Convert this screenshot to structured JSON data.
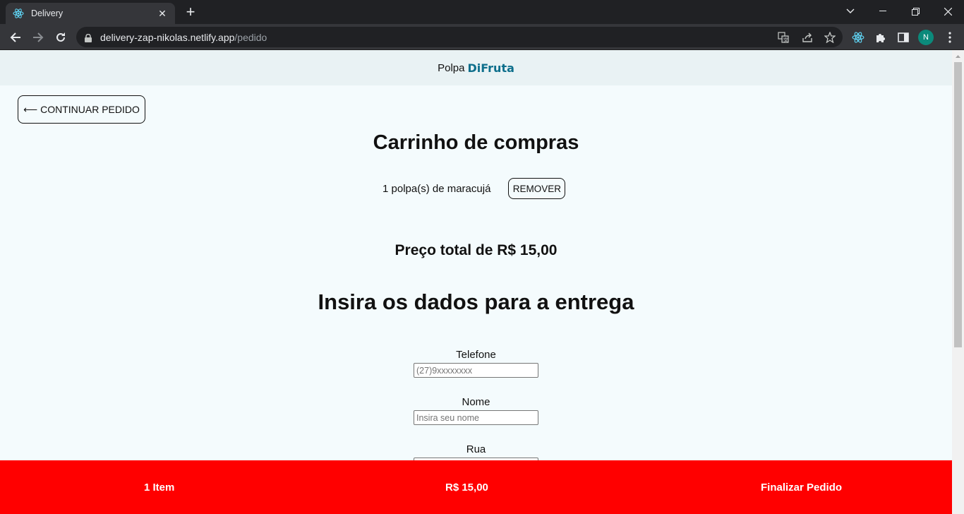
{
  "browser": {
    "tab_title": "Delivery",
    "url_domain": "delivery-zap-nikolas.netlify.app",
    "url_path": "/pedido",
    "profile_initial": "N"
  },
  "site": {
    "brand_prefix": "Polpa",
    "brand_name": "DiFruta"
  },
  "actions": {
    "back_label": "⟵ CONTINUAR PEDIDO",
    "remove_label": "REMOVER"
  },
  "cart": {
    "title": "Carrinho de compras",
    "items": [
      {
        "label": "1 polpa(s) de maracujá"
      }
    ],
    "total": "Preço total de R$ 15,00"
  },
  "form": {
    "title": "Insira os dados para a entrega",
    "fields": [
      {
        "label": "Telefone",
        "placeholder": "(27)9xxxxxxxx"
      },
      {
        "label": "Nome",
        "placeholder": "Insira seu nome"
      },
      {
        "label": "Rua",
        "placeholder": ""
      }
    ]
  },
  "footer": {
    "items_count": "1 Item",
    "price": "R$ 15,00",
    "finish_label": "Finalizar Pedido"
  },
  "colors": {
    "footer_bg": "#ff0000",
    "brand": "#0e6f8c",
    "page_bg": "#f4fbfd"
  }
}
